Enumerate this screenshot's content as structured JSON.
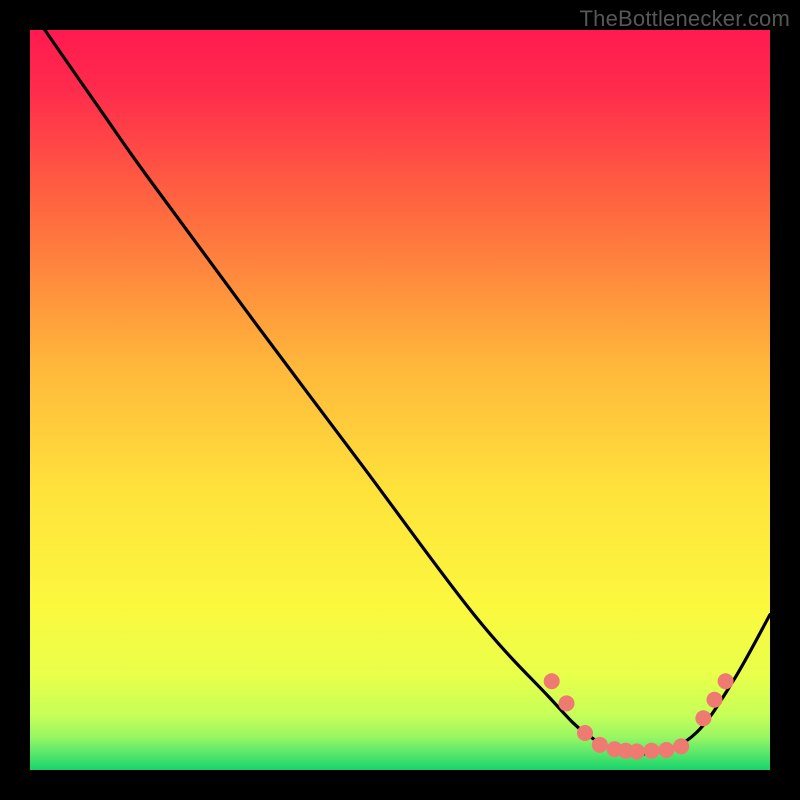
{
  "watermark": "TheBottlenecker.com",
  "chart_data": {
    "type": "line",
    "xlim": [
      0,
      100
    ],
    "ylim": [
      0,
      100
    ],
    "title": "",
    "xlabel": "",
    "ylabel": "",
    "grid": false,
    "gradient": {
      "top": "#ff1a50",
      "mid_upper": "#ff7a3c",
      "mid": "#ffd23b",
      "mid_lower": "#fff53c",
      "bottom": "#1cdc6e"
    },
    "curve": [
      {
        "x": 2,
        "y": 100
      },
      {
        "x": 10,
        "y": 88.5
      },
      {
        "x": 16,
        "y": 80
      },
      {
        "x": 30,
        "y": 61
      },
      {
        "x": 45,
        "y": 41
      },
      {
        "x": 60,
        "y": 21
      },
      {
        "x": 70,
        "y": 10
      },
      {
        "x": 75,
        "y": 5
      },
      {
        "x": 80,
        "y": 2.5
      },
      {
        "x": 85,
        "y": 2.5
      },
      {
        "x": 90,
        "y": 5
      },
      {
        "x": 95,
        "y": 12
      },
      {
        "x": 100,
        "y": 21
      }
    ],
    "markers": [
      {
        "x": 70.5,
        "y": 12
      },
      {
        "x": 72.5,
        "y": 9
      },
      {
        "x": 75,
        "y": 5
      },
      {
        "x": 77,
        "y": 3.4
      },
      {
        "x": 79,
        "y": 2.8
      },
      {
        "x": 80.5,
        "y": 2.6
      },
      {
        "x": 82,
        "y": 2.5
      },
      {
        "x": 84,
        "y": 2.6
      },
      {
        "x": 86,
        "y": 2.7
      },
      {
        "x": 88,
        "y": 3.2
      },
      {
        "x": 91,
        "y": 7
      },
      {
        "x": 92.5,
        "y": 9.5
      },
      {
        "x": 94,
        "y": 12
      }
    ]
  }
}
